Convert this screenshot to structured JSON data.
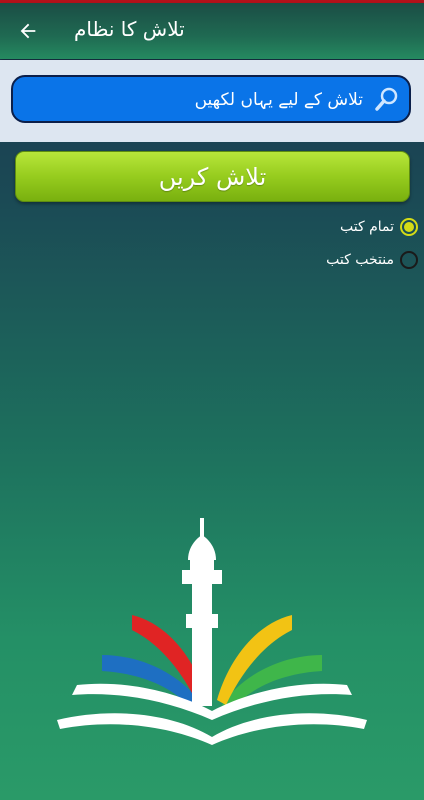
{
  "app_bar": {
    "title": "تلاش کا نظام",
    "back_icon": "arrow-left-icon"
  },
  "search": {
    "placeholder": "تلاش کے لیے یہاں لکھیں",
    "value": "",
    "icon": "search-icon"
  },
  "search_button": {
    "label": "تلاش کریں"
  },
  "scope_options": [
    {
      "label": "تمام کتب",
      "selected": true
    },
    {
      "label": "منتخب کتب",
      "selected": false
    }
  ],
  "colors": {
    "accent_red": "#b5121b",
    "search_blue": "#0a74e8",
    "button_green": "#96cc1e",
    "radio_selected": "#d4dc16"
  },
  "logo": {
    "icon": "minaret-open-book-logo"
  }
}
